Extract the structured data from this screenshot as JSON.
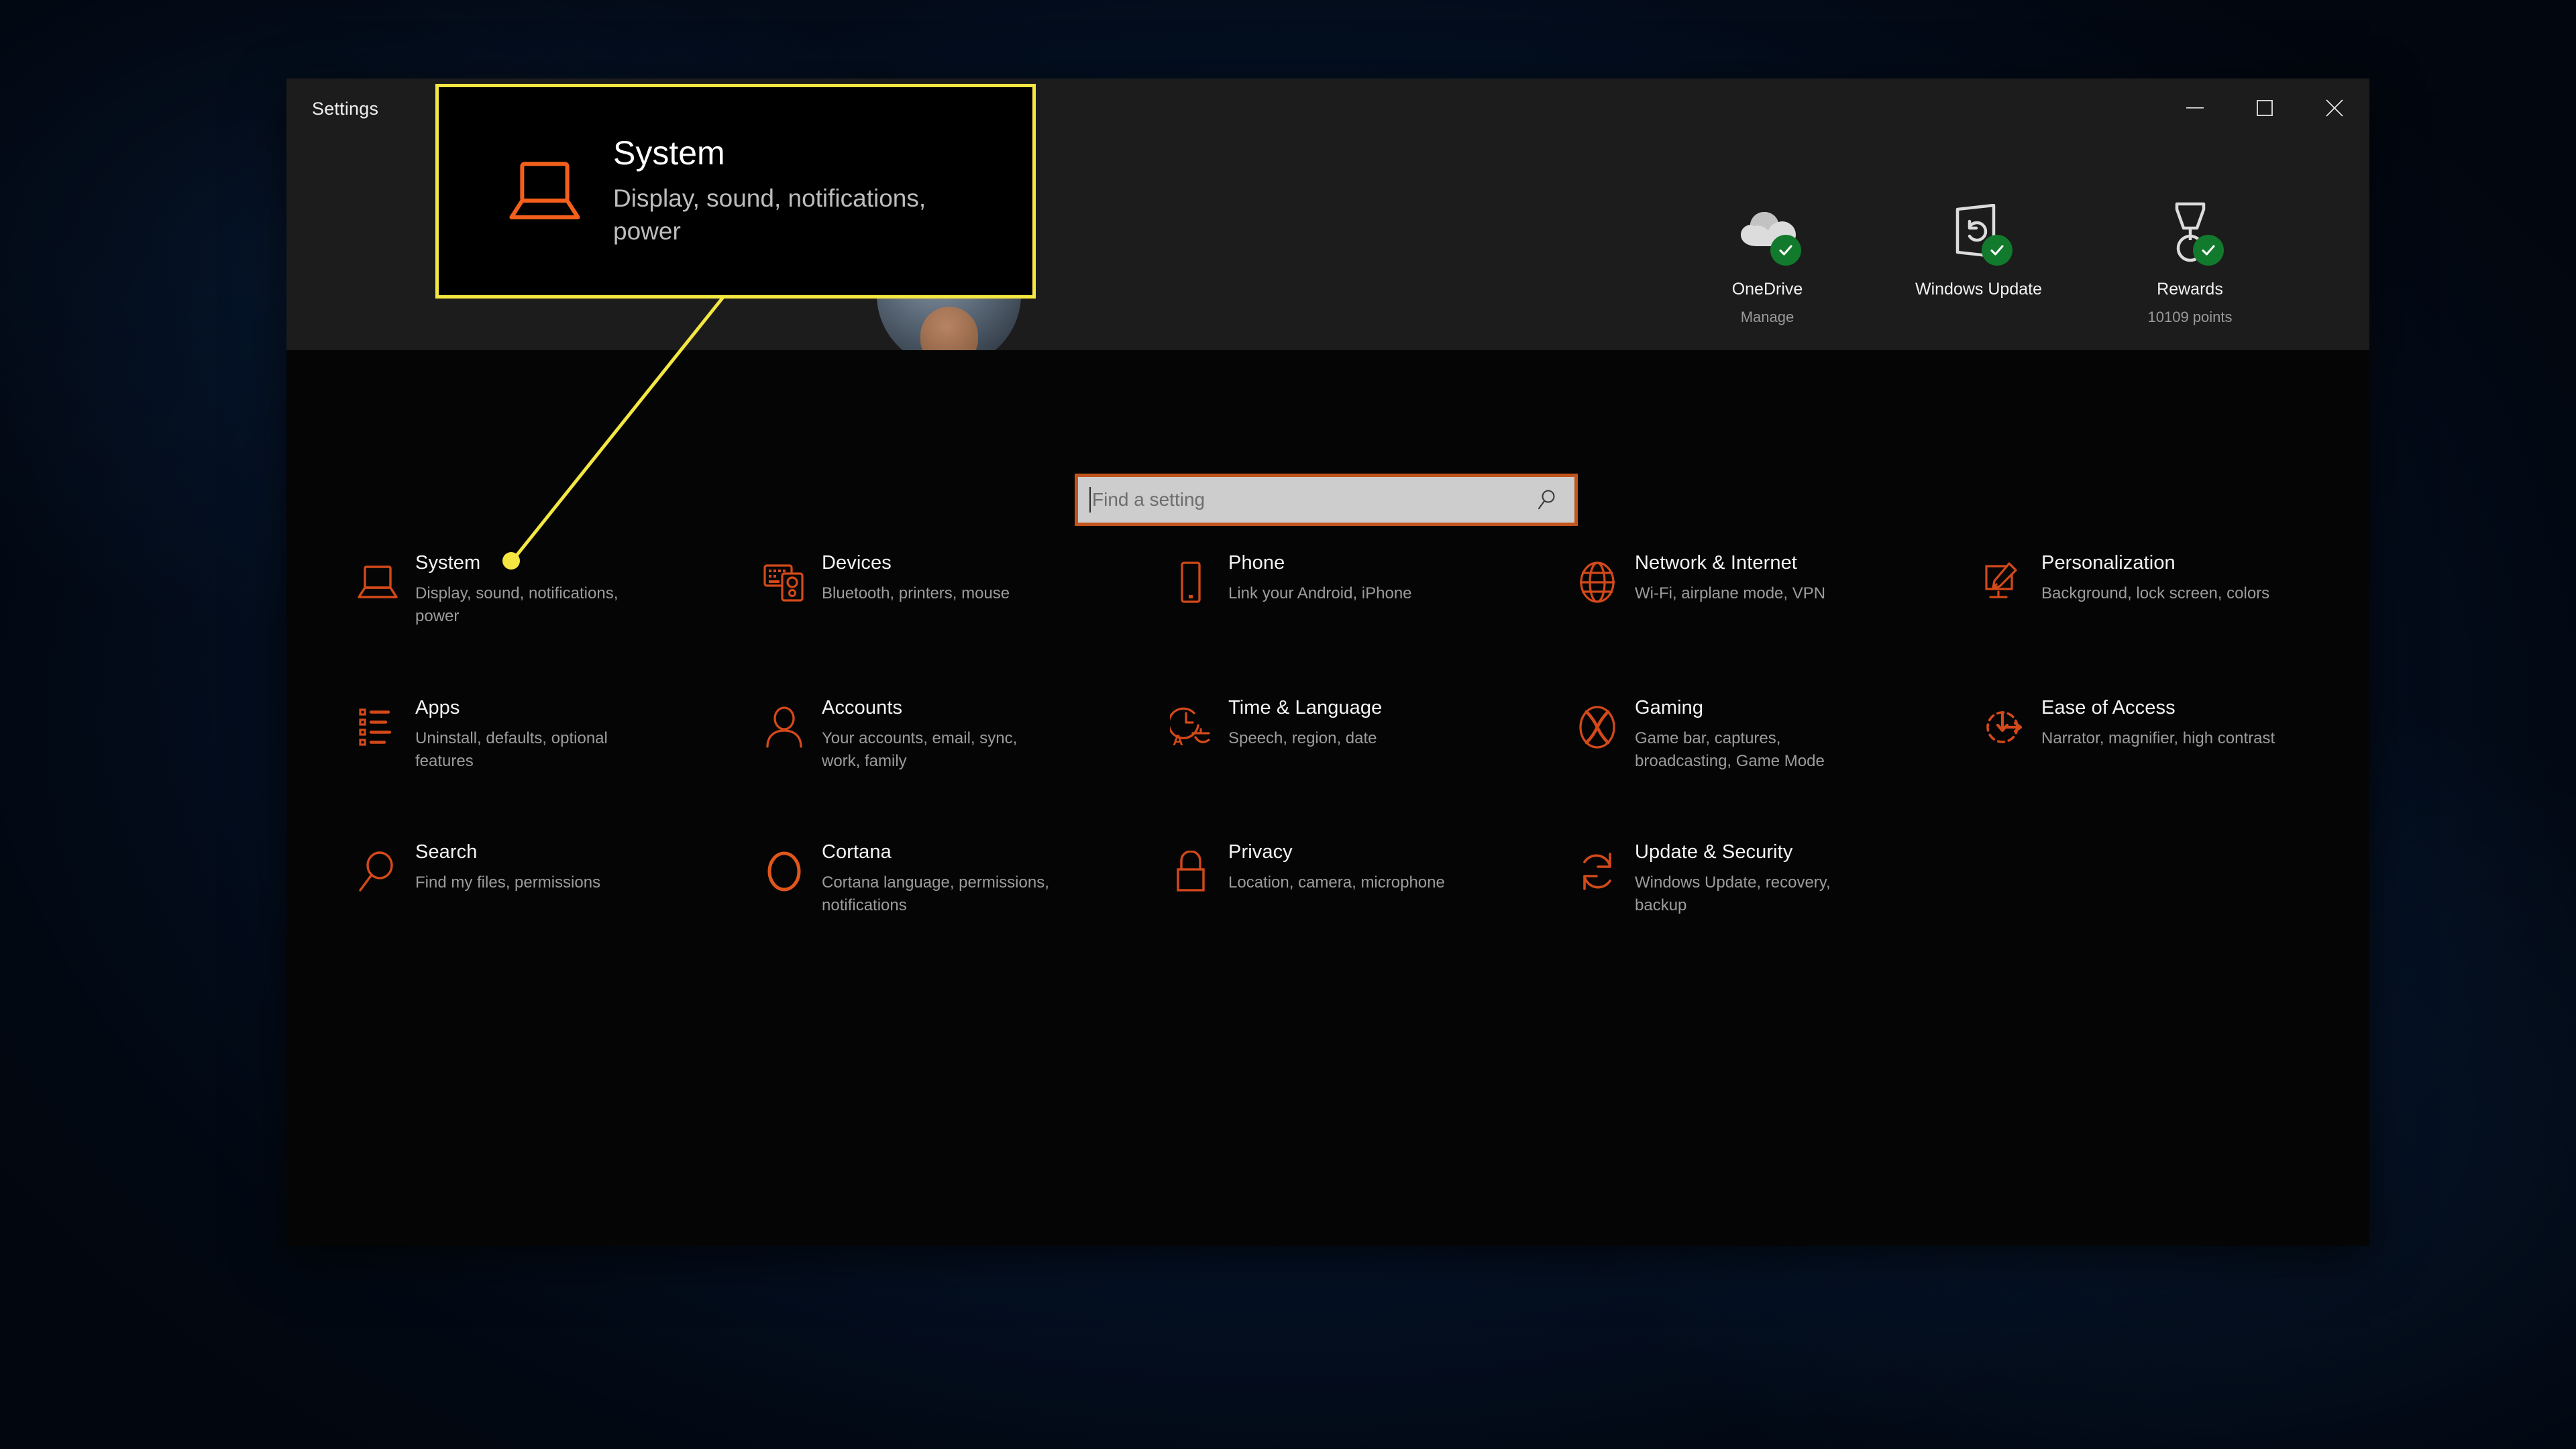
{
  "window": {
    "title": "Settings",
    "controls": [
      {
        "name": "minimize",
        "label": "Minimize"
      },
      {
        "name": "maximize",
        "label": "Maximize"
      },
      {
        "name": "close",
        "label": "Close"
      }
    ]
  },
  "header": {
    "status_tiles": [
      {
        "icon": "onedrive-cloud-icon",
        "title": "OneDrive",
        "subtitle": "Manage",
        "badge": "check"
      },
      {
        "icon": "windows-update-icon",
        "title": "Windows Update",
        "subtitle": "",
        "badge": "check"
      },
      {
        "icon": "rewards-medal-icon",
        "title": "Rewards",
        "subtitle": "10109 points",
        "badge": "check"
      }
    ]
  },
  "search": {
    "placeholder": "Find a setting",
    "value": "",
    "icon": "search-icon"
  },
  "tiles": [
    {
      "icon": "system-laptop-icon",
      "title": "System",
      "subtitle": "Display, sound, notifications, power"
    },
    {
      "icon": "devices-icon",
      "title": "Devices",
      "subtitle": "Bluetooth, printers, mouse"
    },
    {
      "icon": "phone-icon",
      "title": "Phone",
      "subtitle": "Link your Android, iPhone"
    },
    {
      "icon": "network-globe-icon",
      "title": "Network & Internet",
      "subtitle": "Wi-Fi, airplane mode, VPN"
    },
    {
      "icon": "personalization-brush-icon",
      "title": "Personalization",
      "subtitle": "Background, lock screen, colors"
    },
    {
      "icon": "apps-list-icon",
      "title": "Apps",
      "subtitle": "Uninstall, defaults, optional features"
    },
    {
      "icon": "accounts-person-icon",
      "title": "Accounts",
      "subtitle": "Your accounts, email, sync, work, family"
    },
    {
      "icon": "time-language-icon",
      "title": "Time & Language",
      "subtitle": "Speech, region, date"
    },
    {
      "icon": "gaming-xbox-icon",
      "title": "Gaming",
      "subtitle": "Game bar, captures, broadcasting, Game Mode"
    },
    {
      "icon": "ease-of-access-icon",
      "title": "Ease of Access",
      "subtitle": "Narrator, magnifier, high contrast"
    },
    {
      "icon": "search-magnifier-icon",
      "title": "Search",
      "subtitle": "Find my files, permissions"
    },
    {
      "icon": "cortana-ring-icon",
      "title": "Cortana",
      "subtitle": "Cortana language, permissions, notifications"
    },
    {
      "icon": "privacy-lock-icon",
      "title": "Privacy",
      "subtitle": "Location, camera, microphone"
    },
    {
      "icon": "update-security-icon",
      "title": "Update & Security",
      "subtitle": "Windows Update, recovery, backup"
    }
  ],
  "annotation": {
    "callout": {
      "icon": "system-laptop-icon",
      "title": "System",
      "subtitle": "Display, sound, notifications, power"
    },
    "highlight_color": "#f5e642",
    "target_label": "System"
  },
  "colors": {
    "accent_orange": "#f4601b",
    "highlight_yellow": "#f5e642",
    "badge_green": "#127a2c",
    "search_border": "#c2541e",
    "desktop_blue": "#06162e"
  }
}
